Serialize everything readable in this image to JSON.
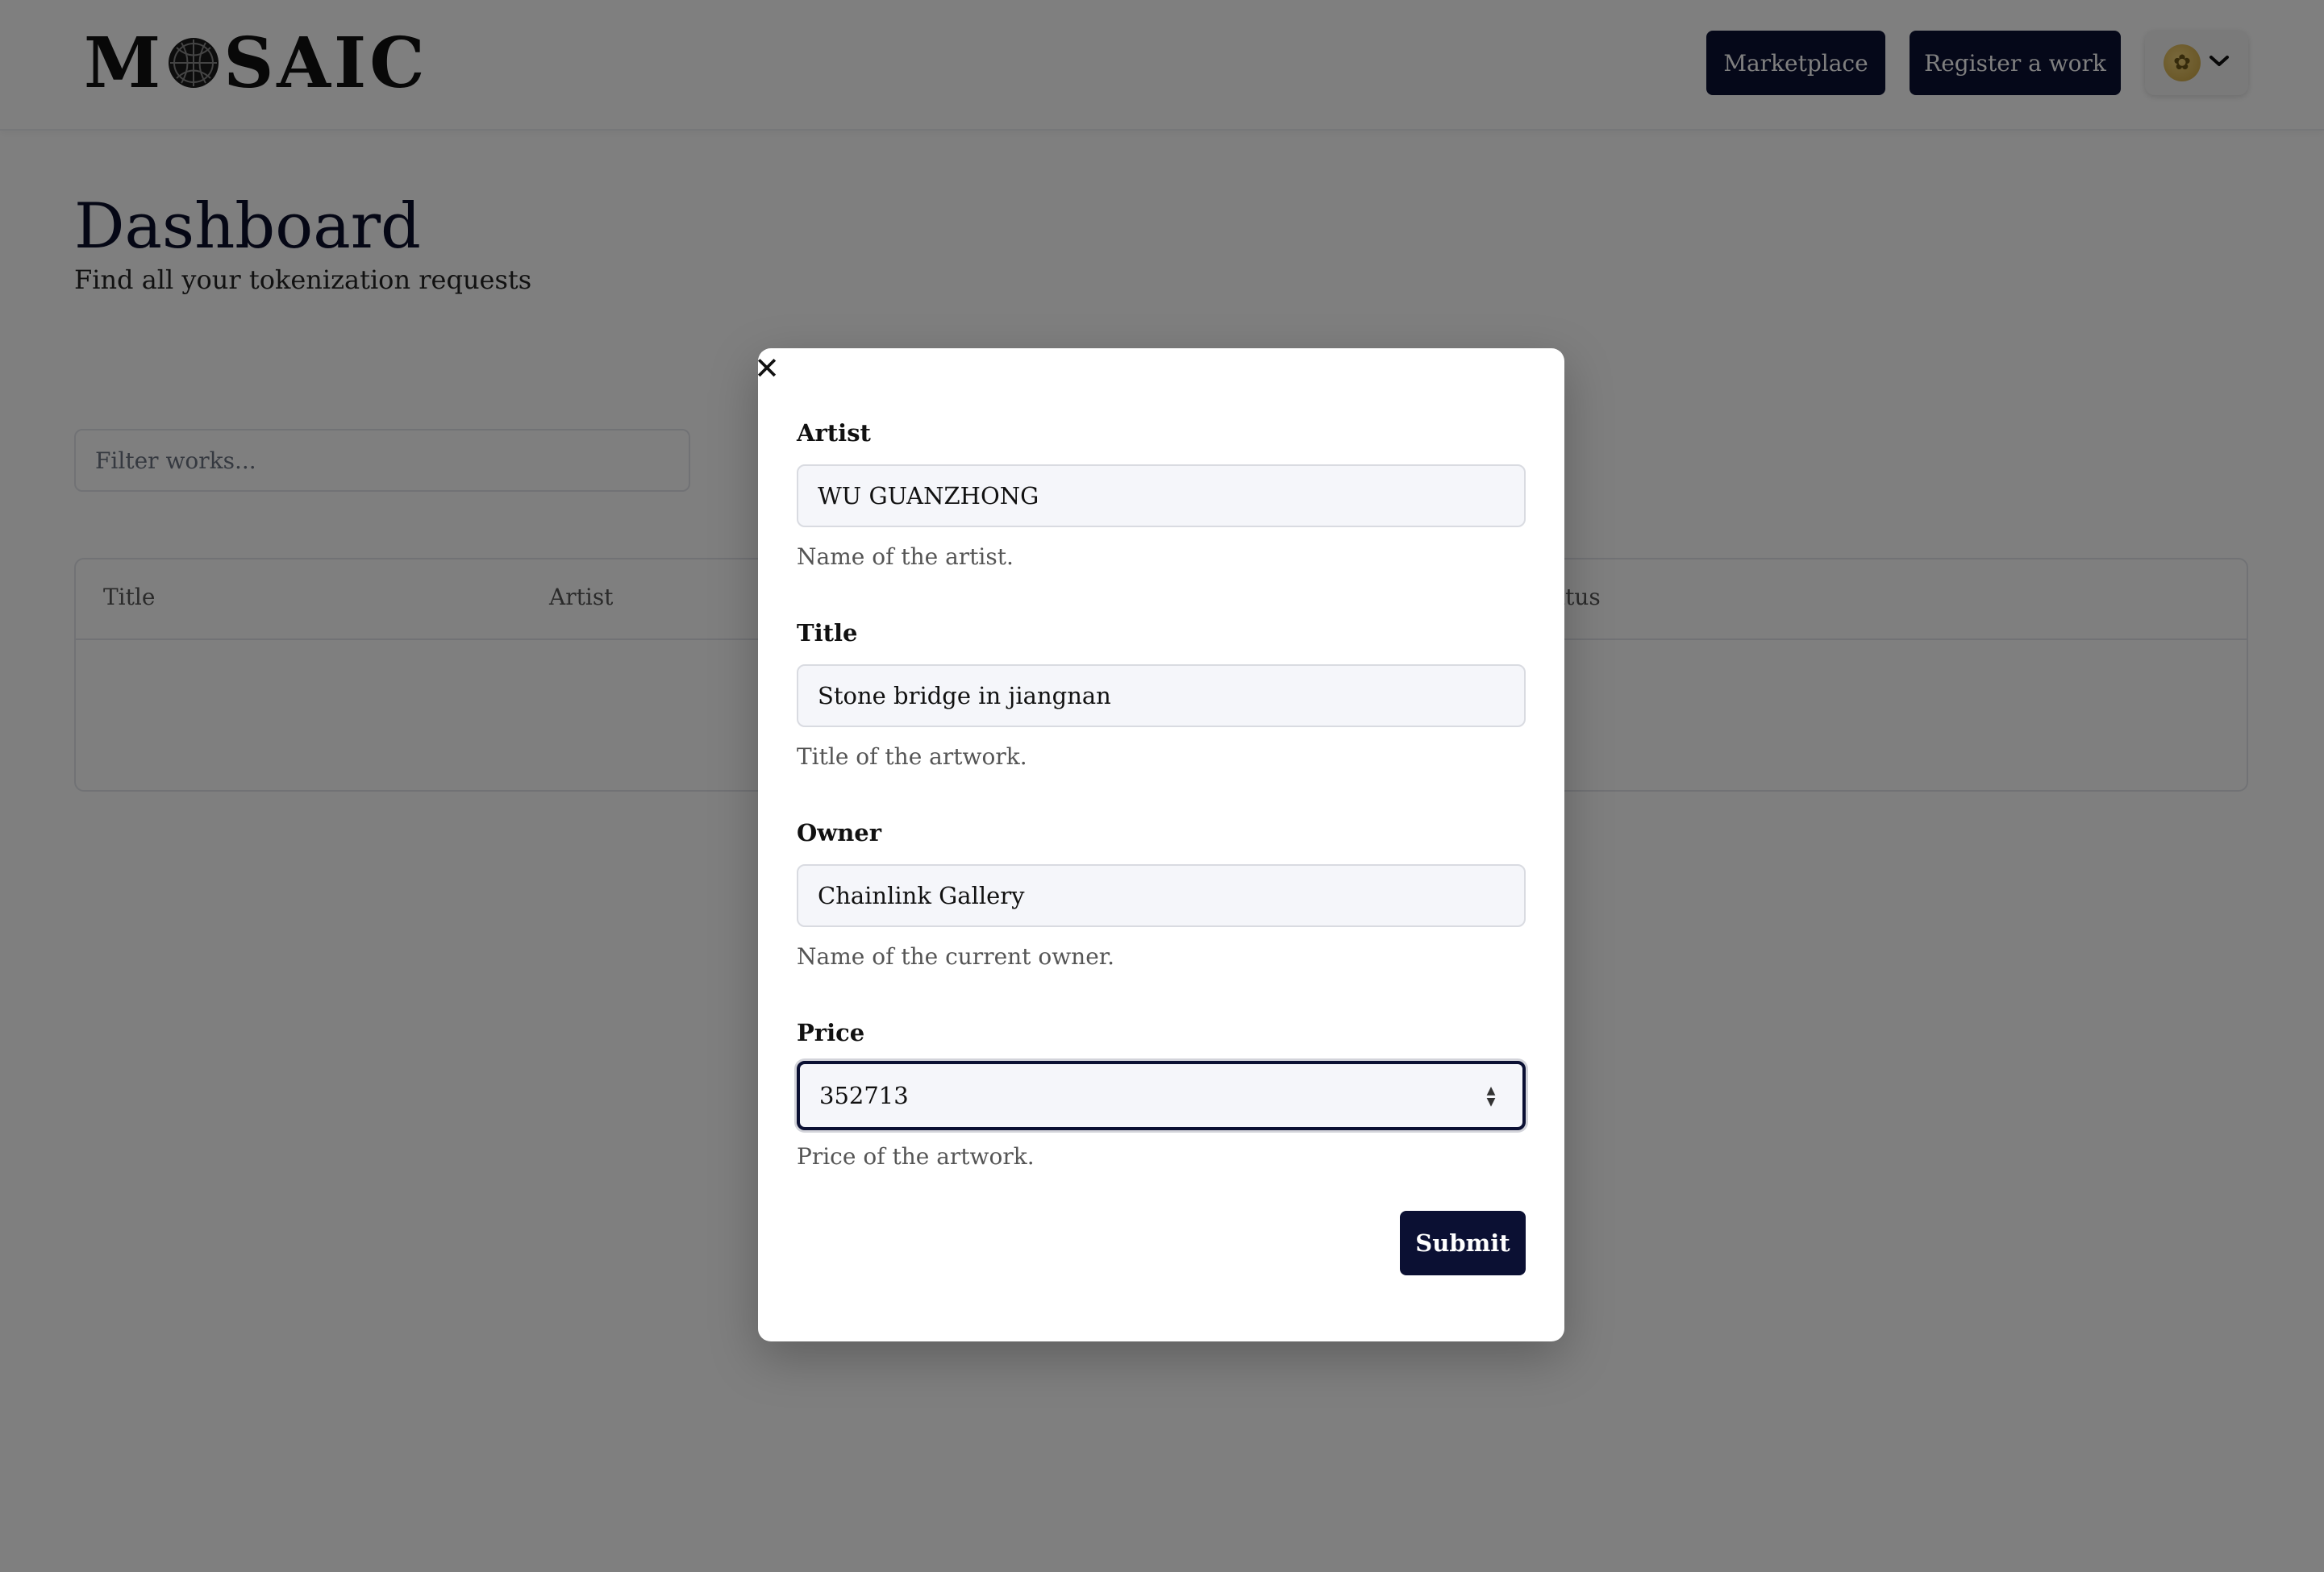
{
  "header": {
    "logo_text_prefix": "M",
    "logo_text_suffix": "SAIC",
    "marketplace_label": "Marketplace",
    "register_label": "Register a work"
  },
  "dashboard": {
    "title": "Dashboard",
    "subtitle": "Find all your tokenization requests",
    "filter_placeholder": "Filter works...",
    "table_columns": [
      "Title",
      "Artist",
      "Status"
    ]
  },
  "modal": {
    "fields": [
      {
        "label": "Artist",
        "value": "WU GUANZHONG",
        "help": "Name of the artist."
      },
      {
        "label": "Title",
        "value": "Stone bridge in jiangnan",
        "help": "Title of the artwork."
      },
      {
        "label": "Owner",
        "value": "Chainlink Gallery",
        "help": "Name of the current owner."
      },
      {
        "label": "Price",
        "value": "352713",
        "help": "Price of the artwork."
      }
    ],
    "submit_label": "Submit"
  },
  "icons": {
    "close": "close-icon",
    "chevron": "chevron-down-icon",
    "globe": "globe-icon",
    "stepper": "number-stepper-icon"
  },
  "colors": {
    "primary": "#0b1033",
    "overlay": "rgba(0,0,0,0.5)"
  }
}
